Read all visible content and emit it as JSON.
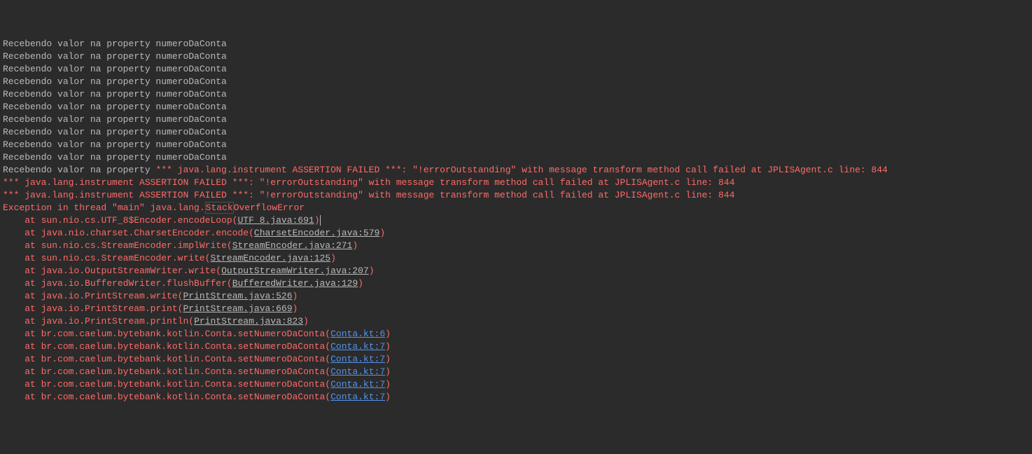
{
  "repeat_line": "Recebendo valor na property numeroDaConta",
  "repeat_count": 10,
  "partial_before_assert": "Recebendo valor na property ",
  "assertion_line": "*** java.lang.instrument ASSERTION FAILED ***: \"!errorOutstanding\" with message transform method call failed at JPLISAgent.c line: 844",
  "exception_prefix": "Exception in thread \"main\" java.lang.",
  "exception_highlight": "Stack",
  "exception_suffix": "OverflowError",
  "stack_indent": "    ",
  "at": "at ",
  "frames": [
    {
      "method": "sun.nio.cs.UTF_8$Encoder.encodeLoop",
      "src": "UTF_8.java:691",
      "link_type": "underline",
      "cursor_after": true
    },
    {
      "method": "java.nio.charset.CharsetEncoder.encode",
      "src": "CharsetEncoder.java:579",
      "link_type": "underline"
    },
    {
      "method": "sun.nio.cs.StreamEncoder.implWrite",
      "src": "StreamEncoder.java:271",
      "link_type": "underline"
    },
    {
      "method": "sun.nio.cs.StreamEncoder.write",
      "src": "StreamEncoder.java:125",
      "link_type": "underline"
    },
    {
      "method": "java.io.OutputStreamWriter.write",
      "src": "OutputStreamWriter.java:207",
      "link_type": "underline"
    },
    {
      "method": "java.io.BufferedWriter.flushBuffer",
      "src": "BufferedWriter.java:129",
      "link_type": "underline"
    },
    {
      "method": "java.io.PrintStream.write",
      "src": "PrintStream.java:526",
      "link_type": "underline"
    },
    {
      "method": "java.io.PrintStream.print",
      "src": "PrintStream.java:669",
      "link_type": "underline"
    },
    {
      "method": "java.io.PrintStream.println",
      "src": "PrintStream.java:823",
      "link_type": "underline"
    },
    {
      "method": "br.com.caelum.bytebank.kotlin.Conta.setNumeroDaConta",
      "src": "Conta.kt:6",
      "link_type": "link"
    },
    {
      "method": "br.com.caelum.bytebank.kotlin.Conta.setNumeroDaConta",
      "src": "Conta.kt:7",
      "link_type": "link"
    },
    {
      "method": "br.com.caelum.bytebank.kotlin.Conta.setNumeroDaConta",
      "src": "Conta.kt:7",
      "link_type": "link"
    },
    {
      "method": "br.com.caelum.bytebank.kotlin.Conta.setNumeroDaConta",
      "src": "Conta.kt:7",
      "link_type": "link"
    },
    {
      "method": "br.com.caelum.bytebank.kotlin.Conta.setNumeroDaConta",
      "src": "Conta.kt:7",
      "link_type": "link"
    },
    {
      "method": "br.com.caelum.bytebank.kotlin.Conta.setNumeroDaConta",
      "src": "Conta.kt:7",
      "link_type": "link"
    }
  ]
}
